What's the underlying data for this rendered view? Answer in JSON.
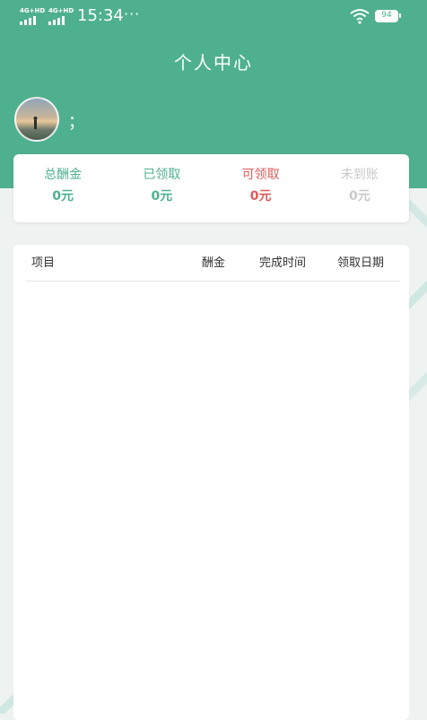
{
  "status_bar": {
    "signal1": "4G+HD",
    "signal2": "4G+HD",
    "time": "15:34",
    "dots": "···",
    "battery": "94"
  },
  "header": {
    "title": "个人中心"
  },
  "user": {
    "name": "；"
  },
  "stats": [
    {
      "label": "总酬金",
      "value": "0元",
      "color": "#4fb08f"
    },
    {
      "label": "已领取",
      "value": "0元",
      "color": "#4fb08f"
    },
    {
      "label": "可领取",
      "value": "0元",
      "color": "#e05a5a"
    },
    {
      "label": "未到账",
      "value": "0元",
      "color": "#c9c9c9"
    }
  ],
  "table": {
    "columns": [
      "项目",
      "酬金",
      "完成时间",
      "领取日期"
    ]
  },
  "colors": {
    "brand": "#4fb08f",
    "alert": "#e05a5a",
    "muted": "#c9c9c9"
  }
}
